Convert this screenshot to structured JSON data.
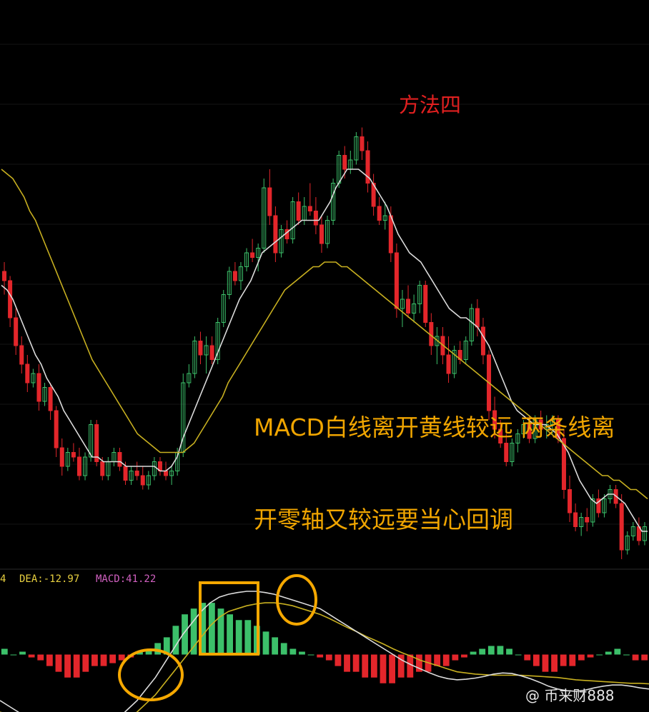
{
  "annotation": {
    "method_title": "方法四",
    "note_line1": "MACD白线离开黄线较远 两条线离",
    "note_line2": "开零轴又较远要当心回调"
  },
  "indicator_labels": {
    "cut_prefix": "4",
    "dea": "DEA:-12.97",
    "macd": "MACD:41.22"
  },
  "watermark": "@ 币来财888",
  "colors": {
    "background": "#000000",
    "up_candle": "#3cc06a",
    "down_candle": "#e3262b",
    "fast_line": "#dcdcdc",
    "slow_line": "#c8b020",
    "highlight": "#f5a800",
    "dea_label": "#e8d040",
    "macd_label": "#d060c0",
    "title": "#e02020"
  },
  "chart_data": [
    {
      "type": "candlestick",
      "title": "",
      "price_range": [
        0,
        100
      ],
      "candles": [
        [
          60,
          62,
          55,
          58
        ],
        [
          58,
          59,
          48,
          50
        ],
        [
          50,
          52,
          42,
          44
        ],
        [
          44,
          46,
          38,
          40
        ],
        [
          40,
          42,
          34,
          36
        ],
        [
          36,
          39,
          35,
          38
        ],
        [
          38,
          40,
          30,
          32
        ],
        [
          32,
          36,
          31,
          35
        ],
        [
          35,
          36,
          28,
          30
        ],
        [
          30,
          31,
          20,
          22
        ],
        [
          22,
          24,
          16,
          18
        ],
        [
          18,
          22,
          17,
          21
        ],
        [
          21,
          23,
          19,
          20
        ],
        [
          20,
          22,
          15,
          16
        ],
        [
          16,
          21,
          15,
          20
        ],
        [
          20,
          28,
          19,
          27
        ],
        [
          27,
          28,
          18,
          19
        ],
        [
          19,
          20,
          15,
          16
        ],
        [
          16,
          20,
          15,
          19
        ],
        [
          19,
          22,
          18,
          21
        ],
        [
          21,
          22,
          17,
          18
        ],
        [
          18,
          19,
          14,
          15
        ],
        [
          15,
          18,
          14,
          17
        ],
        [
          17,
          19,
          15,
          16
        ],
        [
          16,
          18,
          13,
          14
        ],
        [
          14,
          17,
          13,
          16
        ],
        [
          16,
          20,
          15,
          19
        ],
        [
          19,
          20,
          16,
          17
        ],
        [
          17,
          19,
          15,
          16
        ],
        [
          16,
          18,
          14,
          17
        ],
        [
          17,
          22,
          16,
          21
        ],
        [
          21,
          38,
          20,
          36
        ],
        [
          36,
          40,
          35,
          38
        ],
        [
          38,
          46,
          37,
          45
        ],
        [
          45,
          47,
          40,
          42
        ],
        [
          42,
          46,
          38,
          44
        ],
        [
          44,
          46,
          40,
          41
        ],
        [
          41,
          50,
          40,
          49
        ],
        [
          49,
          56,
          48,
          55
        ],
        [
          55,
          61,
          54,
          60
        ],
        [
          60,
          62,
          57,
          58
        ],
        [
          58,
          62,
          56,
          61
        ],
        [
          61,
          65,
          60,
          64
        ],
        [
          64,
          67,
          62,
          63
        ],
        [
          63,
          66,
          60,
          65
        ],
        [
          65,
          80,
          64,
          78
        ],
        [
          78,
          82,
          70,
          72
        ],
        [
          72,
          74,
          62,
          64
        ],
        [
          64,
          70,
          63,
          69
        ],
        [
          69,
          71,
          66,
          67
        ],
        [
          67,
          76,
          66,
          75
        ],
        [
          75,
          77,
          70,
          71
        ],
        [
          71,
          76,
          70,
          74
        ],
        [
          74,
          79,
          72,
          73
        ],
        [
          73,
          76,
          68,
          70
        ],
        [
          70,
          72,
          64,
          66
        ],
        [
          66,
          72,
          65,
          71
        ],
        [
          71,
          80,
          70,
          79
        ],
        [
          79,
          86,
          78,
          85
        ],
        [
          85,
          87,
          80,
          82
        ],
        [
          82,
          86,
          81,
          84
        ],
        [
          84,
          90,
          83,
          89
        ],
        [
          89,
          91,
          84,
          86
        ],
        [
          86,
          88,
          77,
          79
        ],
        [
          79,
          81,
          72,
          74
        ],
        [
          74,
          76,
          70,
          71
        ],
        [
          71,
          75,
          69,
          72
        ],
        [
          72,
          74,
          62,
          64
        ],
        [
          64,
          66,
          50,
          52
        ],
        [
          52,
          56,
          48,
          54
        ],
        [
          54,
          57,
          50,
          51
        ],
        [
          51,
          55,
          49,
          53
        ],
        [
          53,
          58,
          51,
          57
        ],
        [
          57,
          58,
          48,
          49
        ],
        [
          49,
          51,
          42,
          44
        ],
        [
          44,
          48,
          40,
          46
        ],
        [
          46,
          48,
          40,
          42
        ],
        [
          42,
          46,
          36,
          38
        ],
        [
          38,
          44,
          37,
          43
        ],
        [
          43,
          45,
          40,
          41
        ],
        [
          41,
          46,
          40,
          45
        ],
        [
          45,
          53,
          44,
          52
        ],
        [
          52,
          54,
          46,
          48
        ],
        [
          48,
          50,
          40,
          42
        ],
        [
          42,
          43,
          28,
          30
        ],
        [
          30,
          33,
          24,
          26
        ],
        [
          26,
          28,
          22,
          23
        ],
        [
          23,
          25,
          18,
          19
        ],
        [
          19,
          24,
          18,
          23
        ],
        [
          23,
          26,
          21,
          25
        ],
        [
          25,
          28,
          24,
          27
        ],
        [
          27,
          29,
          23,
          24
        ],
        [
          24,
          29,
          23,
          28
        ],
        [
          28,
          30,
          25,
          26
        ],
        [
          26,
          29,
          24,
          27
        ],
        [
          27,
          29,
          25,
          28
        ],
        [
          28,
          29,
          23,
          24
        ],
        [
          24,
          26,
          11,
          13
        ],
        [
          13,
          16,
          6,
          8
        ],
        [
          8,
          10,
          4,
          5
        ],
        [
          5,
          8,
          3,
          7
        ],
        [
          7,
          9,
          4,
          6
        ],
        [
          6,
          12,
          5,
          11
        ],
        [
          11,
          13,
          7,
          8
        ],
        [
          8,
          12,
          7,
          11
        ],
        [
          11,
          14,
          10,
          13
        ],
        [
          13,
          14,
          9,
          10
        ],
        [
          10,
          12,
          -2,
          0
        ],
        [
          0,
          4,
          -1,
          3
        ],
        [
          3,
          6,
          2,
          5
        ],
        [
          5,
          7,
          1,
          2
        ],
        [
          2,
          6,
          1,
          5
        ]
      ],
      "series": [
        {
          "name": "",
          "values": [
            57,
            56,
            54,
            51,
            48,
            45,
            42,
            40,
            37,
            35,
            33,
            30,
            28,
            26,
            24,
            22,
            20,
            20,
            19,
            19,
            19,
            19,
            18,
            18,
            18,
            18,
            18,
            18,
            17,
            17,
            18,
            20,
            24,
            27,
            30,
            33,
            36,
            39,
            42,
            45,
            48,
            51,
            54,
            56,
            58,
            61,
            64,
            65,
            66,
            67,
            68,
            69,
            70,
            71,
            71,
            71,
            71,
            73,
            75,
            78,
            80,
            82,
            82,
            82,
            81,
            80,
            78,
            76,
            74,
            71,
            68,
            66,
            64,
            63,
            62,
            60,
            58,
            56,
            54,
            52,
            51,
            50,
            50,
            49,
            48,
            46,
            44,
            41,
            38,
            35,
            32,
            30,
            29,
            28,
            27,
            27,
            27,
            26,
            25,
            23,
            21,
            18,
            15,
            13,
            11,
            10,
            11,
            12,
            12,
            11,
            10,
            8,
            6,
            4,
            4
          ]
        },
        {
          "name": "",
          "values": [
            82,
            81,
            80,
            78,
            76,
            73,
            71,
            68,
            65,
            62,
            59,
            56,
            53,
            50,
            47,
            44,
            41,
            39,
            37,
            35,
            33,
            31,
            29,
            27,
            25,
            24,
            23,
            22,
            21,
            21,
            21,
            21,
            21,
            22,
            23,
            25,
            27,
            29,
            31,
            33,
            36,
            38,
            40,
            42,
            44,
            46,
            48,
            50,
            52,
            54,
            56,
            57,
            58,
            59,
            60,
            61,
            61,
            62,
            62,
            62,
            61,
            61,
            60,
            59,
            58,
            57,
            56,
            55,
            54,
            53,
            52,
            51,
            50,
            49,
            48,
            47,
            46,
            45,
            44,
            43,
            42,
            41,
            40,
            39,
            38,
            37,
            36,
            35,
            34,
            33,
            32,
            31,
            30,
            29,
            28,
            27,
            26,
            25,
            24,
            23,
            22,
            21,
            20,
            19,
            18,
            17,
            16,
            16,
            15,
            15,
            14,
            13,
            13,
            12,
            11
          ]
        }
      ]
    },
    {
      "type": "bar",
      "title": "",
      "ylim": [
        -10,
        12
      ],
      "values": [
        1,
        0,
        0.5,
        -0.5,
        -1,
        -2,
        -3,
        -4,
        -4,
        -3,
        -2,
        -2,
        -1.5,
        -1,
        -0.5,
        0.5,
        1,
        2,
        3,
        5,
        7,
        8,
        9,
        9,
        8,
        7,
        6,
        6,
        5,
        4,
        3,
        2,
        1,
        0.5,
        0,
        -0.5,
        -1,
        -2,
        -3,
        -3,
        -4,
        -4,
        -5,
        -5,
        -4,
        -4,
        -3,
        -3,
        -2,
        -2,
        -1,
        -0.5,
        0.5,
        1,
        1.5,
        1.5,
        1,
        0,
        -1,
        -2,
        -3,
        -3,
        -2,
        -2,
        -1,
        -0.5,
        0,
        0.5,
        1,
        0,
        -1,
        -1
      ],
      "series": [
        {
          "name": "DEA",
          "values": [
            -10,
            -10.5,
            -11,
            -11.5,
            -12,
            -12.3,
            -12.5,
            -12.7,
            -12.9,
            -13,
            -12.9,
            -12.8,
            -12.5,
            -12,
            -11,
            -10,
            -8.5,
            -7,
            -5,
            -3,
            -1,
            1,
            3,
            5,
            6.5,
            7.5,
            8,
            8.5,
            8.8,
            9,
            9,
            8.8,
            8.5,
            8,
            7.5,
            7,
            6.3,
            5.5,
            4.7,
            4,
            3.2,
            2.5,
            1.8,
            1,
            0.3,
            -0.3,
            -1,
            -1.5,
            -2,
            -2.5,
            -3,
            -3.2,
            -3.4,
            -3.5,
            -3.6,
            -3.6,
            -3.6,
            -3.6,
            -3.7,
            -3.8,
            -3.9,
            -4,
            -4.2,
            -4.4,
            -4.5,
            -4.6,
            -4.7,
            -4.8,
            -4.9,
            -5,
            -5,
            -5.1
          ]
        },
        {
          "name": "MACD",
          "values": [
            -8,
            -9,
            -10,
            -11,
            -12,
            -12.5,
            -13,
            -13.3,
            -13.5,
            -13.5,
            -13.2,
            -12.8,
            -12,
            -11,
            -9.5,
            -8,
            -6,
            -4,
            -1.5,
            1,
            3.5,
            5.5,
            7.5,
            9,
            10,
            10.5,
            10.8,
            11,
            11,
            10.8,
            10.5,
            10,
            9.5,
            9,
            8.5,
            8,
            7,
            6,
            5,
            4,
            3,
            2,
            1,
            0,
            -1,
            -1.8,
            -2.5,
            -3.2,
            -3.8,
            -4.2,
            -4.4,
            -4.3,
            -4.1,
            -3.8,
            -3.4,
            -3.2,
            -3.3,
            -3.7,
            -4.2,
            -4.8,
            -5.5,
            -6,
            -6.3,
            -6.4,
            -6.2,
            -5.8,
            -5.5,
            -5.3,
            -5.3,
            -5.5,
            -5.8,
            -6
          ]
        }
      ]
    }
  ]
}
